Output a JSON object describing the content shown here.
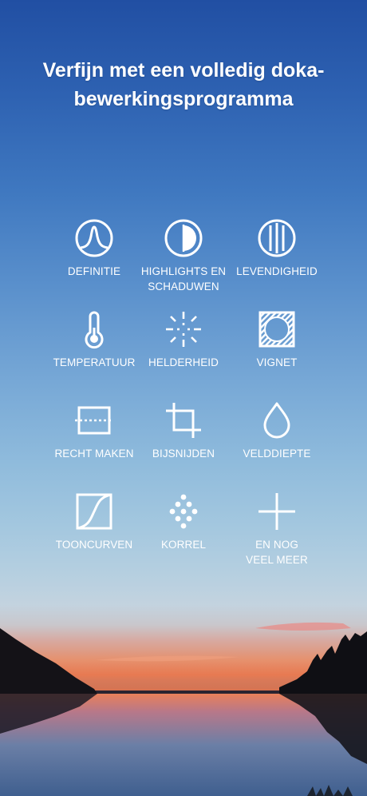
{
  "headline": {
    "line1": "Verfijn met een volledig doka-",
    "line2": "bewerkingsprogramma"
  },
  "tools": {
    "definition": {
      "label": "DEFINITIE",
      "icon": "definition-icon"
    },
    "highlights": {
      "label": "HIGHLIGHTS EN",
      "label2": "SCHADUWEN",
      "icon": "highlights-shadows-icon"
    },
    "vibrance": {
      "label": "LEVENDIGHEID",
      "icon": "vibrance-icon"
    },
    "temperature": {
      "label": "TEMPERATUUR",
      "icon": "thermometer-icon"
    },
    "brightness": {
      "label": "HELDERHEID",
      "icon": "brightness-icon"
    },
    "vignette": {
      "label": "VIGNET",
      "icon": "vignette-icon"
    },
    "straighten": {
      "label": "RECHT MAKEN",
      "icon": "straighten-icon"
    },
    "crop": {
      "label": "BIJSNIJDEN",
      "icon": "crop-icon"
    },
    "depth": {
      "label": "VELDDIEPTE",
      "icon": "depth-of-field-icon"
    },
    "curves": {
      "label": "TOONCURVEN",
      "icon": "tone-curve-icon"
    },
    "grain": {
      "label": "KORREL",
      "icon": "grain-icon"
    },
    "more": {
      "label": "EN NOG",
      "label2": "VEEL MEER",
      "icon": "plus-icon"
    }
  }
}
